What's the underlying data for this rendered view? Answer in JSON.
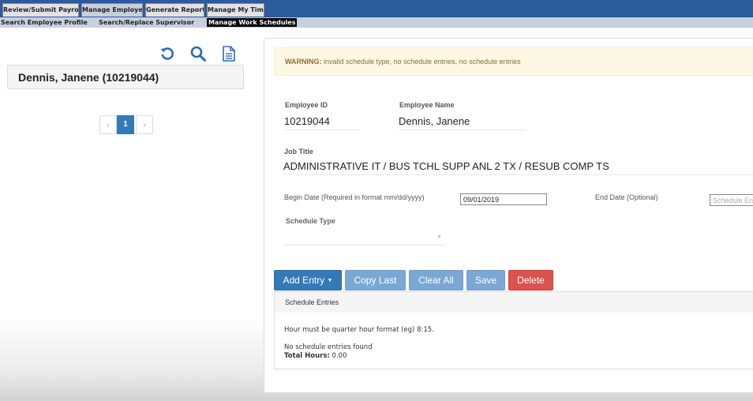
{
  "nav": {
    "tabs": [
      "Review/Submit Payroll",
      "Manage Employee",
      "Generate Reports",
      "Manage My Time"
    ],
    "active_tab": "Manage Employee",
    "sub_links": [
      "Search Employee Profile",
      "Search/Replace Supervisor",
      "Manage Work Schedules"
    ],
    "active_sub_link": "Manage Work Schedules"
  },
  "sidebar": {
    "icons": [
      "refresh-icon",
      "search-icon",
      "document-icon"
    ],
    "employee_card": "Dennis, Janene (10219044)",
    "pager": {
      "prev": "‹",
      "current": "1",
      "next": "›"
    }
  },
  "warning": {
    "prefix": "WARNING:",
    "message": "invalid schedule type, no schedule entries, no schedule entries"
  },
  "form": {
    "employee_id_label": "Employee ID",
    "employee_id": "10219044",
    "employee_name_label": "Employee Name",
    "employee_name": "Dennis, Janene",
    "job_title_label": "Job Title",
    "job_title": "ADMINISTRATIVE IT / BUS TCHL SUPP ANL 2 TX / RESUB COMP TS",
    "begin_date_label": "Begin Date (Required in format mm/dd/yyyy)",
    "begin_date": "09/01/2019",
    "end_date_label": "End Date (Optional)",
    "end_date_placeholder": "Schedule Entry",
    "schedule_type_label": "Schedule Type",
    "schedule_type_value": ""
  },
  "buttons": {
    "add_entry": "Add Entry",
    "copy_last": "Copy Last",
    "clear_all": "Clear All",
    "save": "Save",
    "delete": "Delete"
  },
  "entries": {
    "header": "Schedule Entries",
    "hint": "Hour must be quarter hour format (eg) 8:15.",
    "empty": "No schedule entries found",
    "total_label": "Total Hours:",
    "total_value": "0.00"
  },
  "colors": {
    "nav_bar": "#2a5b9b",
    "sub_bar": "#c7d0de",
    "primary": "#337ab7",
    "danger": "#d9534f",
    "warning_bg": "#fcf8e3",
    "warning_text": "#8a6d3b"
  }
}
